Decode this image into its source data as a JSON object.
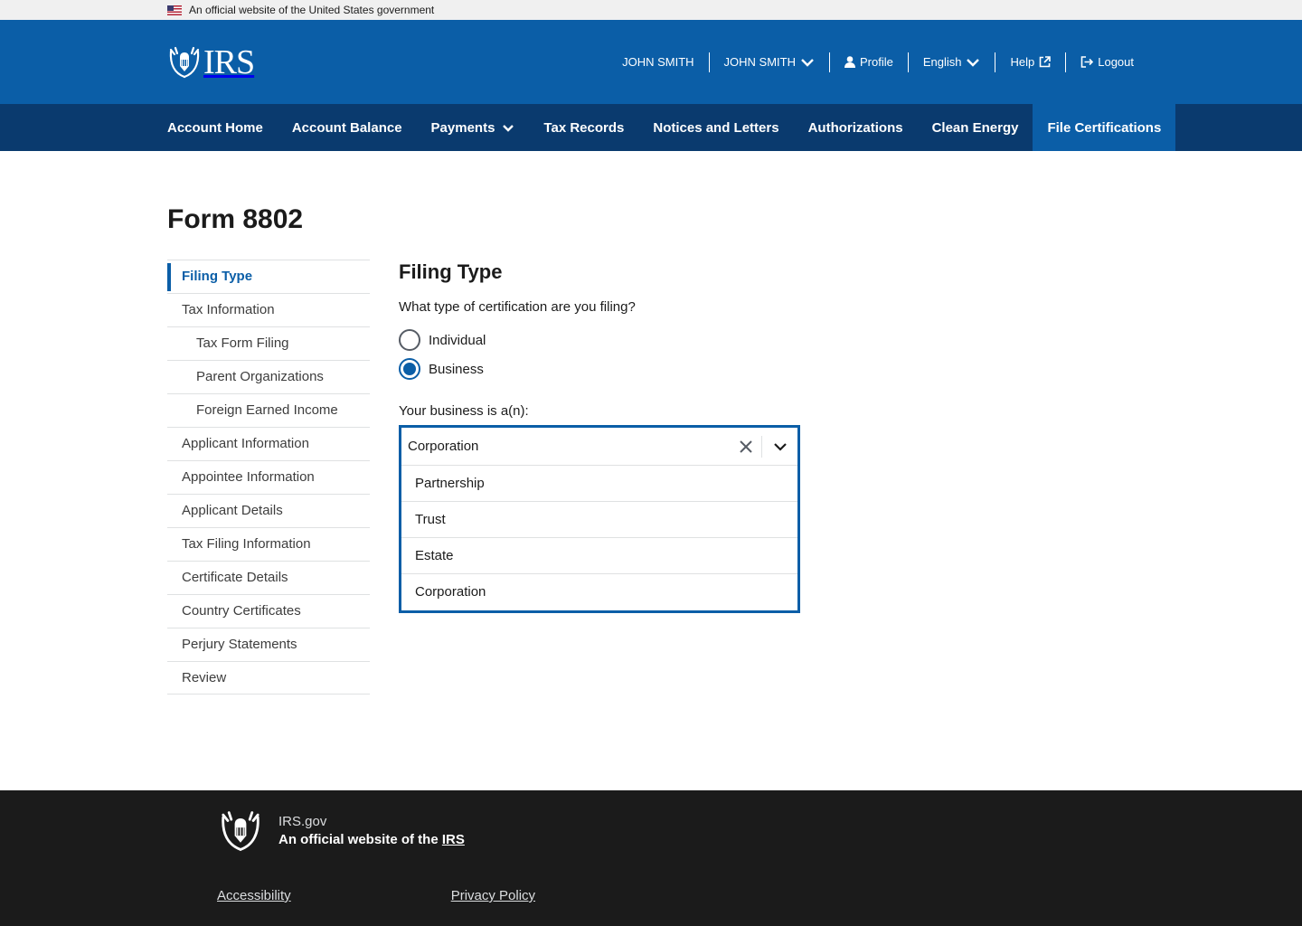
{
  "gov_banner": {
    "text": "An official website of the United States government",
    "flag_icon": "us-flag-icon"
  },
  "header": {
    "logo_text": "IRS",
    "utility": [
      {
        "label": "JOHN SMITH"
      },
      {
        "label": "JOHN SMITH",
        "icon": "chevron-down-icon"
      },
      {
        "label": "Profile",
        "icon": "person-icon"
      },
      {
        "label": "English",
        "icon": "chevron-down-icon"
      },
      {
        "label": "Help",
        "icon": "external-link-icon"
      },
      {
        "label": "Logout",
        "icon": "logout-icon"
      }
    ]
  },
  "nav": {
    "items": [
      {
        "label": "Account Home"
      },
      {
        "label": "Account Balance"
      },
      {
        "label": "Payments",
        "icon": "chevron-down-icon"
      },
      {
        "label": "Tax Records"
      },
      {
        "label": "Notices and Letters"
      },
      {
        "label": "Authorizations"
      },
      {
        "label": "Clean Energy"
      },
      {
        "label": "File Certifications",
        "active": true
      }
    ]
  },
  "page": {
    "title": "Form 8802"
  },
  "sidenav": {
    "items": [
      {
        "label": "Filing Type",
        "current": true
      },
      {
        "label": "Tax Information"
      },
      {
        "label": "Tax Form Filing",
        "sub": true
      },
      {
        "label": "Parent Organizations",
        "sub": true
      },
      {
        "label": "Foreign Earned Income",
        "sub": true
      },
      {
        "label": "Applicant Information"
      },
      {
        "label": "Appointee Information"
      },
      {
        "label": "Applicant Details"
      },
      {
        "label": "Tax Filing Information"
      },
      {
        "label": "Certificate Details"
      },
      {
        "label": "Country Certificates"
      },
      {
        "label": "Perjury Statements"
      },
      {
        "label": "Review"
      }
    ]
  },
  "form": {
    "heading": "Filing Type",
    "question": "What type of certification are you filing?",
    "options": [
      {
        "label": "Individual",
        "checked": false
      },
      {
        "label": "Business",
        "checked": true
      }
    ],
    "business_label": "Your business is a(n):",
    "combo": {
      "value": "Corporation",
      "clear_icon": "close-icon",
      "toggle_icon": "chevron-down-icon",
      "list": [
        "Partnership",
        "Trust",
        "Estate",
        "Corporation"
      ]
    }
  },
  "footer": {
    "site": "IRS.gov",
    "tagline_prefix": "An official website of the",
    "tagline_link": "IRS",
    "links": [
      "Accessibility",
      "Privacy Policy"
    ]
  },
  "colors": {
    "primary": "#0b5ea7",
    "nav_dark": "#0a3a6e",
    "footer": "#1b1b1b",
    "banner": "#f0f0f0"
  }
}
